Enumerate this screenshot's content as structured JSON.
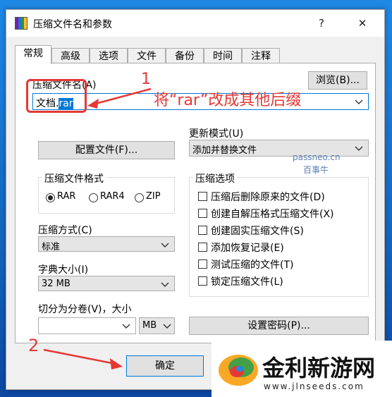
{
  "window": {
    "title": "压缩文件名和参数",
    "help": "?",
    "close": "✕"
  },
  "tabs": [
    {
      "label": "常规"
    },
    {
      "label": "高级"
    },
    {
      "label": "选项"
    },
    {
      "label": "文件"
    },
    {
      "label": "备份"
    },
    {
      "label": "时间"
    },
    {
      "label": "注释"
    }
  ],
  "archive_name": {
    "label": "压缩文件名(A)",
    "base": "文档.",
    "selected": "rar"
  },
  "browse_button": "浏览(B)...",
  "update_mode": {
    "label": "更新模式(U)",
    "value": "添加并替换文件"
  },
  "profile_button": "配置文件(F)...",
  "format": {
    "label": "压缩文件格式",
    "options": [
      "RAR",
      "RAR4",
      "ZIP"
    ],
    "selected": "RAR"
  },
  "method": {
    "label": "压缩方式(C)",
    "value": "标准"
  },
  "dict": {
    "label": "字典大小(I)",
    "value": "32 MB"
  },
  "split": {
    "label": "切分为分卷(V)，大小",
    "unit": "MB"
  },
  "options_group": {
    "label": "压缩选项",
    "items": [
      "压缩后删除原来的文件(D)",
      "创建自解压格式压缩文件(X)",
      "创建固实压缩文件(S)",
      "添加恢复记录(E)",
      "测试压缩的文件(T)",
      "锁定压缩文件(L)"
    ]
  },
  "password_button": "设置密码(P)...",
  "ok_button": "确定",
  "annotations": {
    "n1": "1",
    "text1": "将“rar”改成其他后缀",
    "n2": "2"
  },
  "watermark": {
    "line1": "passneo.cn",
    "line2": "百事牛"
  },
  "logo": {
    "text": "金利新游网",
    "url": "www.jlnseeds.com"
  },
  "colors": {
    "accent": "#0078d7",
    "annotation": "#e53935"
  }
}
